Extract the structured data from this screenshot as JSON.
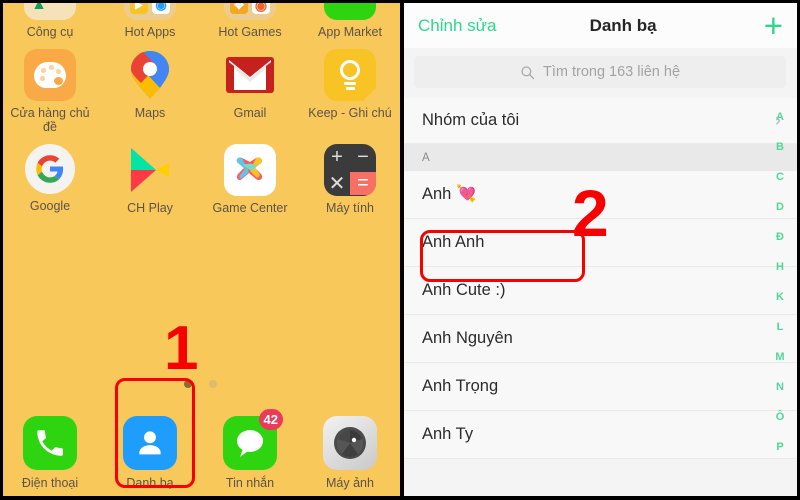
{
  "home": {
    "background_color": "#f9c85a",
    "apps": [
      {
        "label": "Công cụ",
        "icon": "folder-tools-icon"
      },
      {
        "label": "Hot Apps",
        "icon": "folder-hot-apps-icon"
      },
      {
        "label": "Hot Games",
        "icon": "folder-hot-games-icon"
      },
      {
        "label": "App Market",
        "icon": "app-market-icon"
      },
      {
        "label": "Cửa hàng chủ đề",
        "icon": "theme-store-palette-icon"
      },
      {
        "label": "Maps",
        "icon": "google-maps-pin-icon"
      },
      {
        "label": "Gmail",
        "icon": "gmail-envelope-icon"
      },
      {
        "label": "Keep - Ghi chú",
        "icon": "google-keep-bulb-icon"
      },
      {
        "label": "Google",
        "icon": "google-g-icon"
      },
      {
        "label": "CH Play",
        "icon": "google-play-icon"
      },
      {
        "label": "Game Center",
        "icon": "game-center-icon"
      },
      {
        "label": "Máy tính",
        "icon": "calculator-icon"
      }
    ],
    "dock": [
      {
        "label": "Điện thoại",
        "icon": "phone-handset-icon",
        "color": "#2fd411",
        "badge": ""
      },
      {
        "label": "Danh bạ",
        "icon": "contacts-person-icon",
        "color": "#1f9dfc",
        "badge": ""
      },
      {
        "label": "Tin nhắn",
        "icon": "message-bubble-icon",
        "color": "#2fd411",
        "badge": "42"
      },
      {
        "label": "Máy ảnh",
        "icon": "camera-shutter-icon",
        "color": "#d8d8d8",
        "badge": ""
      }
    ],
    "page_dots": {
      "count": 2,
      "active_index": 0,
      "active_color": "#8a6a2e",
      "inactive_color": "#e0b870"
    },
    "annotation": {
      "number": "1",
      "color": "#f70000",
      "highlights": "Danh bạ dock icon"
    }
  },
  "contacts": {
    "header": {
      "edit_label": "Chỉnh sửa",
      "title": "Danh bạ",
      "add_icon": "plus-icon",
      "accent_color": "#2fd68e"
    },
    "search": {
      "placeholder": "Tìm trong 163 liên hệ",
      "icon": "search-icon"
    },
    "groups_row": {
      "label": "Nhóm của tôi",
      "chevron": "chevron-right-icon"
    },
    "section_header": "A",
    "contact_list": [
      {
        "name": "Anh 💘",
        "highlighted": false
      },
      {
        "name": "Anh Anh",
        "highlighted": true
      },
      {
        "name": "Anh Cute :)",
        "highlighted": false
      },
      {
        "name": "Anh Nguyên",
        "highlighted": false
      },
      {
        "name": "Anh Trọng",
        "highlighted": false
      },
      {
        "name": "Anh Ty",
        "highlighted": false
      }
    ],
    "alphabet_index": [
      "A",
      "B",
      "C",
      "D",
      "Đ",
      "H",
      "K",
      "L",
      "M",
      "N",
      "Ô",
      "P"
    ],
    "annotation": {
      "number": "2",
      "color": "#f70000",
      "highlights": "Anh Anh contact row"
    }
  }
}
